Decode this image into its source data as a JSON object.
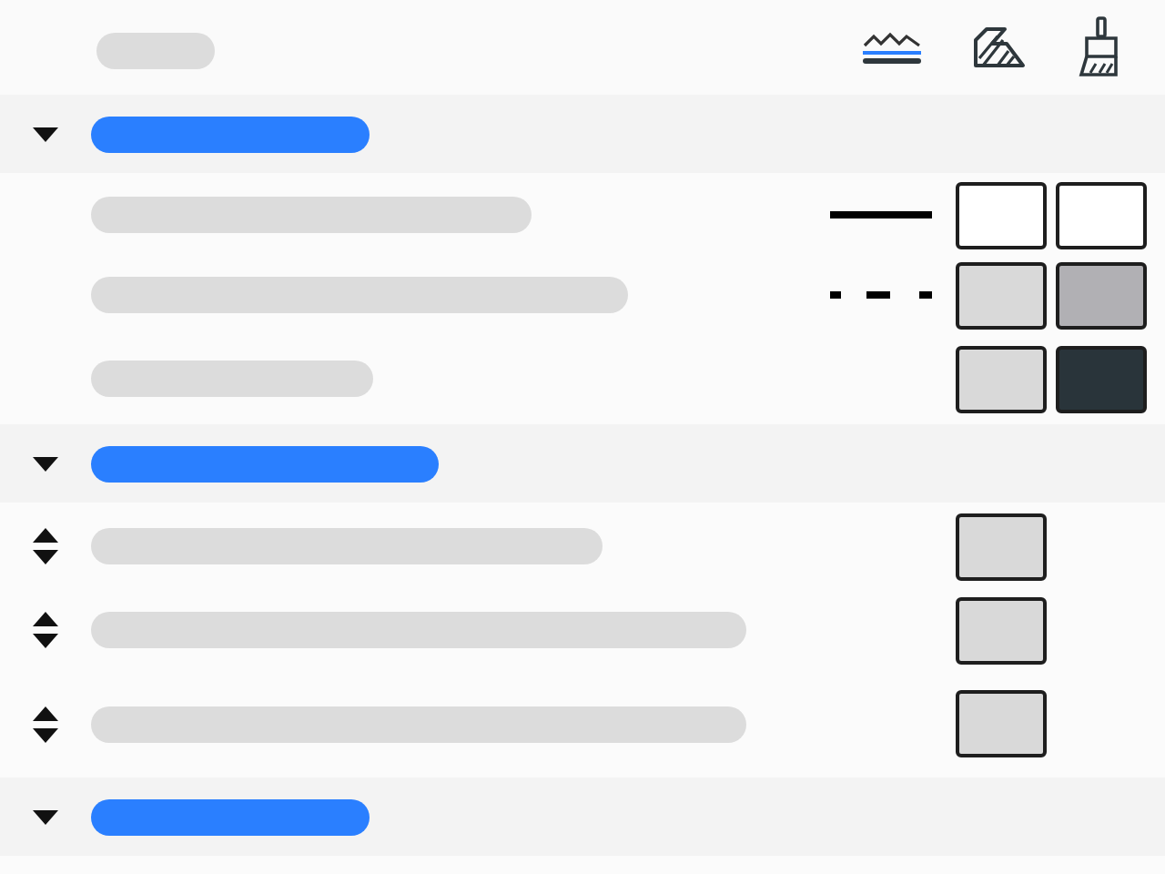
{
  "toolbar": {
    "tools": [
      {
        "kind": "line"
      },
      {
        "kind": "hatch"
      },
      {
        "kind": "brush"
      }
    ]
  },
  "sections": [
    {
      "expanded": true,
      "rows": [
        {
          "kind": "plain",
          "line_sample": {
            "kind": "solid"
          },
          "swatches": [
            {
              "color": "#ffffff"
            },
            {
              "color": "#ffffff"
            }
          ]
        },
        {
          "kind": "plain",
          "line_sample": {
            "kind": "dashed"
          },
          "swatches": [
            {
              "color": "#d9d9d9"
            },
            {
              "color": "#b1b0b4"
            }
          ]
        },
        {
          "kind": "plain",
          "swatches": [
            {
              "color": "#d9d9d9"
            },
            {
              "color": "#29343a"
            }
          ]
        }
      ]
    },
    {
      "expanded": true,
      "rows": [
        {
          "kind": "sortable",
          "swatches": [
            {
              "color": "#d9d9d9"
            }
          ]
        },
        {
          "kind": "sortable",
          "swatches": [
            {
              "color": "#d9d9d9"
            }
          ]
        },
        {
          "kind": "sortable",
          "swatches": [
            {
              "color": "#d9d9d9"
            }
          ]
        }
      ]
    },
    {
      "expanded": true
    }
  ]
}
